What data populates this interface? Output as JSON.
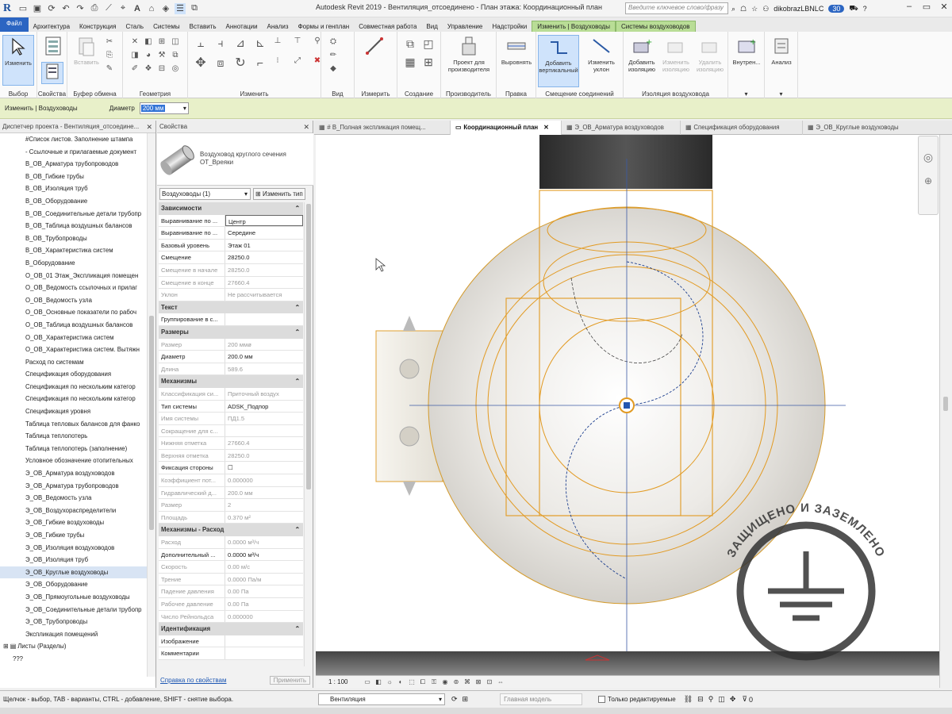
{
  "app": {
    "title": "Autodesk Revit 2019 - Вентиляция_отсоединено - План этажа: Координационный план",
    "search_placeholder": "Введите ключевое слово/фразу",
    "user": "dikobrazLBNLC",
    "notifications": "30"
  },
  "ribbon": {
    "tabs": [
      "Файл",
      "Архитектура",
      "Конструкция",
      "Сталь",
      "Системы",
      "Вставить",
      "Аннотации",
      "Анализ",
      "Формы и генплан",
      "Совместная работа",
      "Вид",
      "Управление",
      "Надстройки",
      "Изменить | Воздуховоды",
      "Системы воздуховодов"
    ],
    "panels": {
      "select": "Выбор",
      "properties": "Свойства",
      "clipboard": "Буфер обмена",
      "geometry": "Геометрия",
      "modify": "Изменить",
      "view": "Вид",
      "measure": "Измерить",
      "create": "Создание",
      "fabrication": "Производитель",
      "edit": "Правка",
      "offset": "Смещение соединений",
      "insulation": "Изоляция воздуховода",
      "analysis": "Анализ"
    },
    "buttons": {
      "modify": "Изменить",
      "paste": "Вставить",
      "fab_project": "Проект для производителя",
      "align": "Выровнять",
      "add_vertical": "Добавить вертикальный",
      "modify_slope": "Изменить уклон",
      "add_insulation": "Добавить изоляцию",
      "edit_insulation": "Изменить изоляцию",
      "remove_insulation": "Удалить изоляцию",
      "inside": "Внутрен...",
      "analysis": "Анализ"
    }
  },
  "options_bar": {
    "context": "Изменить | Воздуховоды",
    "diameter_label": "Диаметр",
    "diameter_value": "200 мм"
  },
  "browser": {
    "header": "Диспетчер проекта - Вентиляция_отсоедине...",
    "items": [
      "#Список листов. Заполнение штампа",
      "- Ссылочные и прилагаемые документ",
      "В_ОВ_Арматура трубопроводов",
      "В_ОВ_Гибкие трубы",
      "В_ОВ_Изоляция труб",
      "В_ОВ_Оборудование",
      "В_ОВ_Соединительные детали трубопр",
      "В_ОВ_Таблица воздушных балансов",
      "В_ОВ_Трубопроводы",
      "В_ОВ_Характеристика систем",
      "В_Оборудование",
      "О_ОВ_01 Этаж_Экспликация помещен",
      "О_ОВ_Ведомость ссылочных и прилаг",
      "О_ОВ_Ведомость узла",
      "О_ОВ_Основные показатели по рабоч",
      "О_ОВ_Таблица воздушных балансов",
      "О_ОВ_Характеристика систем",
      "О_ОВ_Характеристика систем. Вытяжн",
      "Расход по системам",
      "Спецификация оборудования",
      "Спецификация по нескольким категор",
      "Спецификация по нескольким категор",
      "Спецификация уровня",
      "Таблица тепловых балансов для фанко",
      "Таблица теплопотерь",
      "Таблица теплопотерь (заполнение)",
      "Условное обозначение отопительных",
      "Э_ОВ_Арматура воздуховодов",
      "Э_ОВ_Арматура трубопроводов",
      "Э_ОВ_Ведомость узла",
      "Э_ОВ_Воздухораспределители",
      "Э_ОВ_Гибкие воздуховоды",
      "Э_ОВ_Гибкие трубы",
      "Э_ОВ_Изоляция воздуховодов",
      "Э_ОВ_Изоляция труб",
      "Э_ОВ_Круглые воздуховоды",
      "Э_ОВ_Оборудование",
      "Э_ОВ_Прямоугольные воздуховоды",
      "Э_ОВ_Соединительные детали трубопр",
      "Э_ОВ_Трубопроводы",
      "Экспликация помещений",
      "Листы (Разделы)",
      "???"
    ],
    "selected_index": 35
  },
  "properties": {
    "header": "Свойства",
    "type_name_line1": "Воздуховод круглого сечения",
    "type_name_line2": "ОТ_Вреяки",
    "instance_dropdown": "Воздуховоды (1)",
    "edit_type": "Изменить тип",
    "rows": [
      {
        "g": "Зависимости"
      },
      {
        "n": "Выравнивание по ...",
        "v": "Центр"
      },
      {
        "n": "Выравнивание по ...",
        "v": "Середине"
      },
      {
        "n": "Базовый уровень",
        "v": "Этаж 01"
      },
      {
        "n": "Смещение",
        "v": "28250.0"
      },
      {
        "n": "Смещение в начале",
        "v": "28250.0",
        "d": 1
      },
      {
        "n": "Смещение в конце",
        "v": "27660.4",
        "d": 1
      },
      {
        "n": "Уклон",
        "v": "Не рассчитывается",
        "d": 1
      },
      {
        "g": "Текст"
      },
      {
        "n": "Группирование в с...",
        "v": ""
      },
      {
        "g": "Размеры"
      },
      {
        "n": "Размер",
        "v": "200 ммø",
        "d": 1
      },
      {
        "n": "Диаметр",
        "v": "200.0 мм"
      },
      {
        "n": "Длина",
        "v": "589.6",
        "d": 1
      },
      {
        "g": "Механизмы"
      },
      {
        "n": "Классификация си...",
        "v": "Приточный воздух",
        "d": 1
      },
      {
        "n": "Тип системы",
        "v": "ADSK_Подпор"
      },
      {
        "n": "Имя системы",
        "v": "ПД1.5",
        "d": 1
      },
      {
        "n": "Сокращение для с...",
        "v": "",
        "d": 1
      },
      {
        "n": "Нижняя отметка",
        "v": "27660.4",
        "d": 1
      },
      {
        "n": "Верхняя отметка",
        "v": "28250.0",
        "d": 1
      },
      {
        "n": "Фиксация стороны",
        "v": "☐"
      },
      {
        "n": "Коэффициент пот...",
        "v": "0.000000",
        "d": 1
      },
      {
        "n": "Гидравлический д...",
        "v": "200.0 мм",
        "d": 1
      },
      {
        "n": "Размер",
        "v": "2",
        "d": 1
      },
      {
        "n": "Площадь",
        "v": "0.370 м²",
        "d": 1
      },
      {
        "g": "Механизмы - Расход"
      },
      {
        "n": "Расход",
        "v": "0.0000 м³/ч",
        "d": 1
      },
      {
        "n": "Дополнительный ...",
        "v": "0.0000 м³/ч"
      },
      {
        "n": "Скорость",
        "v": "0.00 м/с",
        "d": 1
      },
      {
        "n": "Трение",
        "v": "0.0000 Па/м",
        "d": 1
      },
      {
        "n": "Падение давления",
        "v": "0.00 Па",
        "d": 1
      },
      {
        "n": "Рабочее давление",
        "v": "0.00 Па",
        "d": 1
      },
      {
        "n": "Число Рейнольдса",
        "v": "0.000000",
        "d": 1
      },
      {
        "g": "Идентификация"
      },
      {
        "n": "Изображение",
        "v": ""
      },
      {
        "n": "Комментарии",
        "v": ""
      }
    ],
    "help_link": "Справка по свойствам",
    "apply": "Применить"
  },
  "view_tabs": [
    "# В_Полная экспликация помещ...",
    "Координационный план",
    "Э_ОВ_Арматура воздуховодов",
    "Спецификация оборудования",
    "Э_ОВ_Круглые воздуховоды"
  ],
  "view": {
    "scale": "1 : 100",
    "watermark_top": "ЗАЩИЩЕНО И ЗАЗЕМЛЕНО",
    "watermark_bottom": "ZANDZ.COM"
  },
  "status": {
    "hint": "Щелчок - выбор, TAB - варианты, CTRL - добавление, SHIFT - снятие выбора.",
    "workset": "Вентиляция",
    "model": "Главная модель",
    "editable_only": "Только редактируемые",
    "filter_count": "0"
  },
  "colors": {
    "accent_blue": "#2b65c2",
    "context_tab": "#b9dd96",
    "options_bar": "#e8f0c9",
    "selection_orange": "#e8a020"
  }
}
